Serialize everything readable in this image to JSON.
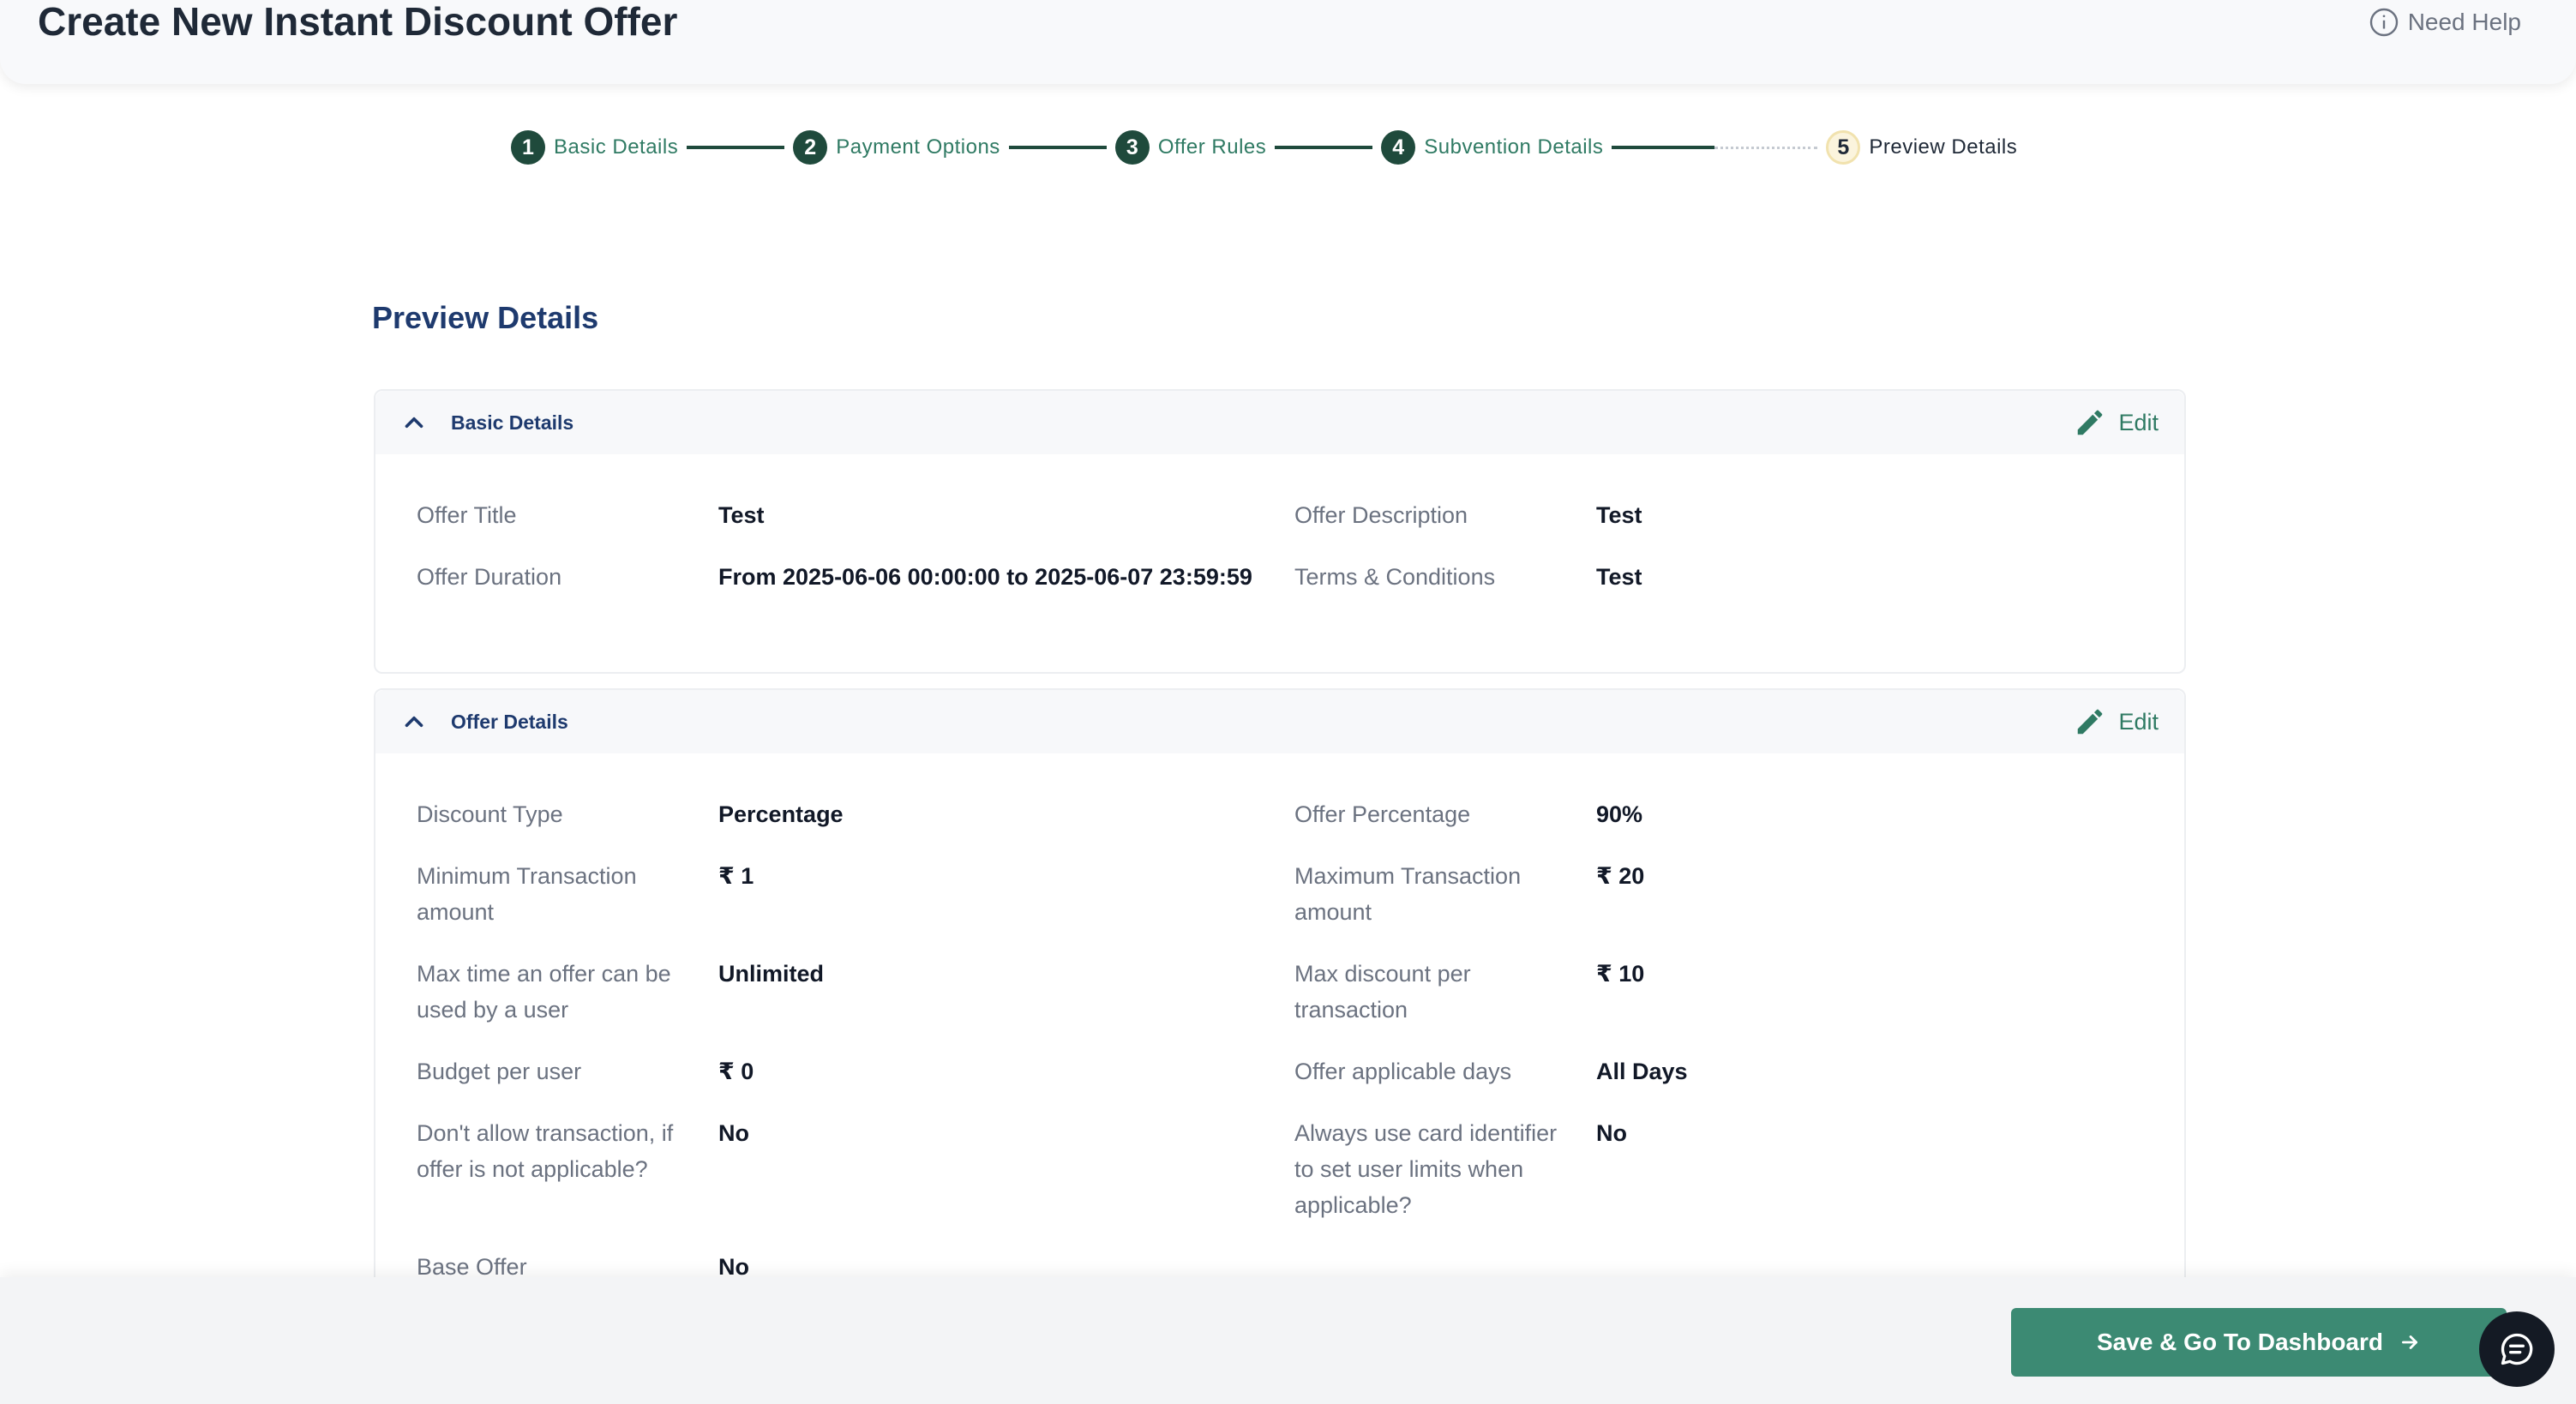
{
  "header": {
    "title": "Create New Instant Discount Offer",
    "help_label": "Need Help"
  },
  "stepper": {
    "steps": [
      {
        "num": "1",
        "label": "Basic Details"
      },
      {
        "num": "2",
        "label": "Payment Options"
      },
      {
        "num": "3",
        "label": "Offer Rules"
      },
      {
        "num": "4",
        "label": "Subvention Details"
      },
      {
        "num": "5",
        "label": "Preview Details"
      }
    ],
    "current_step": 5
  },
  "main": {
    "title": "Preview Details",
    "edit_label": "Edit",
    "basic_details": {
      "title": "Basic Details",
      "rows": [
        {
          "label": "Offer Title",
          "value": "Test",
          "label2": "Offer Description",
          "value2": "Test"
        },
        {
          "label": "Offer Duration",
          "value": "From 2025-06-06 00:00:00 to 2025-06-07 23:59:59",
          "label2": "Terms & Conditions",
          "value2": "Test"
        }
      ]
    },
    "offer_details": {
      "title": "Offer Details",
      "rows": [
        {
          "label": "Discount Type",
          "value": "Percentage",
          "label2": "Offer Percentage",
          "value2": "90%"
        },
        {
          "label": "Minimum Transaction amount",
          "value": "₹ 1",
          "label2": "Maximum Transaction amount",
          "value2": "₹ 20"
        },
        {
          "label": "Max time an offer can be used by a user",
          "value": "Unlimited",
          "label2": "Max discount per transaction",
          "value2": "₹ 10"
        },
        {
          "label": "Budget per user",
          "value": "₹ 0",
          "label2": "Offer applicable days",
          "value2": "All Days"
        },
        {
          "label": "Don't allow transaction, if offer is not applicable?",
          "value": "No",
          "label2": "Always use card identifier to set user limits when applicable?",
          "value2": "No"
        },
        {
          "label": "Base Offer",
          "value": "No"
        }
      ]
    }
  },
  "footer": {
    "save_label": "Save & Go To Dashboard"
  },
  "colors": {
    "primary_green": "#3c8a73",
    "dark_green": "#1f4a3c",
    "heading_navy": "#1e3a6e"
  }
}
